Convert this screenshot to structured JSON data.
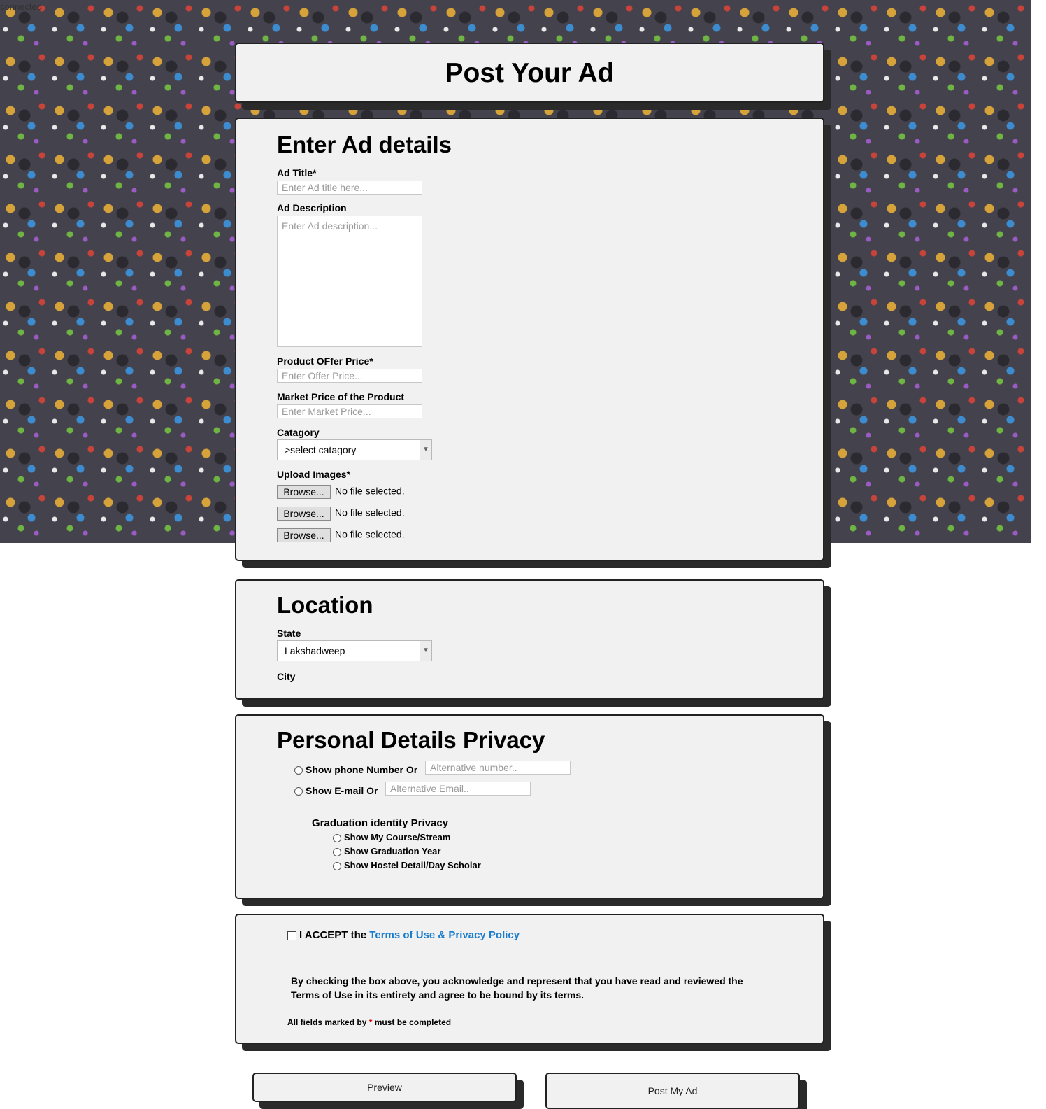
{
  "status": "connected",
  "header": {
    "title": "Post Your Ad"
  },
  "ad_details": {
    "heading": "Enter Ad details",
    "title_label": "Ad Title*",
    "title_placeholder": "Enter Ad title here...",
    "description_label": "Ad Description",
    "description_placeholder": "Enter Ad description...",
    "offer_price_label": "Product OFfer Price*",
    "offer_price_placeholder": "Enter Offer Price...",
    "market_price_label": "Market Price of the Product",
    "market_price_placeholder": "Enter Market Price...",
    "category_label": "Catagory",
    "category_value": ">select catagory",
    "upload_label": "Upload Images*",
    "files": [
      {
        "button": "Browse...",
        "status": "No file selected."
      },
      {
        "button": "Browse...",
        "status": "No file selected."
      },
      {
        "button": "Browse...",
        "status": "No file selected."
      }
    ]
  },
  "location": {
    "heading": "Location",
    "state_label": "State",
    "state_value": "Lakshadweep",
    "city_label": "City"
  },
  "privacy": {
    "heading": "Personal Details Privacy",
    "phone_label": "Show phone Number Or",
    "phone_placeholder": "Alternative number..",
    "email_label": "Show E-mail Or",
    "email_placeholder": "Alternative Email..",
    "graduation_heading": "Graduation identity Privacy",
    "graduation_options": [
      "Show My Course/Stream",
      "Show Graduation Year",
      "Show Hostel Detail/Day Scholar"
    ]
  },
  "terms": {
    "accept_prefix": "I ACCEPT the",
    "accept_link": "Terms of Use & Privacy Policy",
    "acknowledge_line1": "By checking the box above, you acknowledge and represent that you have read and reviewed the",
    "acknowledge_line2": "Terms of Use in its entirety and agree to be bound by its terms.",
    "required_prefix": "All fields marked by",
    "required_star": "*",
    "required_suffix": "must be completed"
  },
  "actions": {
    "preview": "Preview",
    "post": "Post My Ad"
  },
  "colors": {
    "panel_bg": "#f1f1f1",
    "shadow": "#2a2a2a",
    "link": "#1a7ccd",
    "required_star": "#cc0000"
  }
}
